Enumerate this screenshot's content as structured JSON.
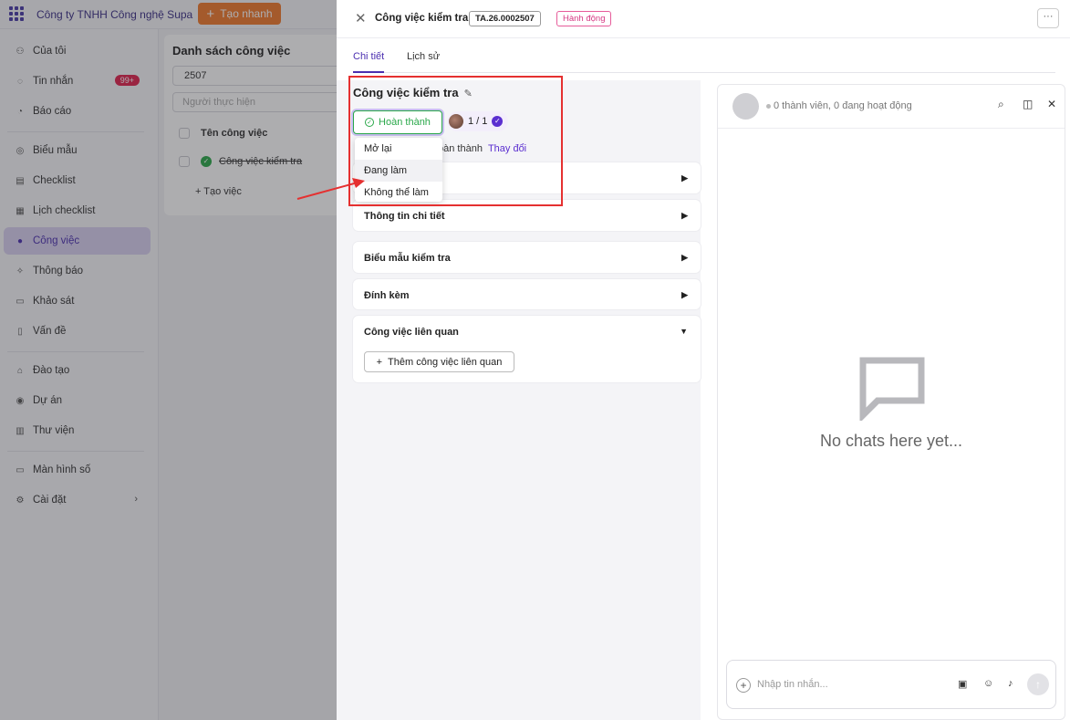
{
  "topbar": {
    "company": "Công ty TNHH Công nghệ Supa",
    "quick_create": "Tạo nhanh"
  },
  "sidebar": {
    "items": [
      {
        "label": "Của tôi",
        "icon": "person-icon"
      },
      {
        "label": "Tin nhắn",
        "icon": "chat-icon",
        "badge": "99+"
      },
      {
        "label": "Báo cáo",
        "icon": "report-icon"
      },
      {
        "label": "Biểu mẫu",
        "icon": "form-icon"
      },
      {
        "label": "Checklist",
        "icon": "checklist-icon"
      },
      {
        "label": "Lịch checklist",
        "icon": "calendar-icon"
      },
      {
        "label": "Công việc",
        "icon": "task-icon",
        "active": true
      },
      {
        "label": "Thông báo",
        "icon": "bell-icon"
      },
      {
        "label": "Khảo sát",
        "icon": "survey-icon"
      },
      {
        "label": "Vấn đề",
        "icon": "issue-icon"
      },
      {
        "label": "Đào tạo",
        "icon": "training-icon"
      },
      {
        "label": "Dự án",
        "icon": "project-icon"
      },
      {
        "label": "Thư viện",
        "icon": "library-icon"
      },
      {
        "label": "Màn hình số",
        "icon": "monitor-icon"
      },
      {
        "label": "Cài đặt",
        "icon": "settings-icon"
      }
    ]
  },
  "task_list": {
    "title": "Danh sách công việc",
    "search_value": "2507",
    "assignee_placeholder": "Người thực hiện",
    "column_name": "Tên công việc",
    "row_name": "Công việc kiểm tra",
    "add_task": "Tạo việc"
  },
  "drawer": {
    "title": "Công việc kiểm tra",
    "code": "TA.26.0002507",
    "action": "Hành động",
    "tabs": [
      "Chi tiết",
      "Lịch sử"
    ],
    "task_title": "Công việc kiểm tra",
    "status": "Hoàn thành",
    "assignee_count": "1 / 1",
    "completed_text": "oàn thành",
    "change_link": "Thay đổi",
    "dropdown": [
      "Mở lại",
      "Đang làm",
      "Không thể làm"
    ],
    "sections": [
      "Thông tin chi tiết",
      "Biểu mẫu kiểm tra",
      "Đính kèm",
      "Công việc liên quan"
    ],
    "add_related": "Thêm công việc liên quan"
  },
  "chat": {
    "meta": "0 thành viên, 0 đang hoạt động",
    "empty": "No chats here yet...",
    "placeholder": "Nhập tin nhắn..."
  },
  "colors": {
    "accent": "#4b2fb0",
    "success": "#2aa84a",
    "quick_create": "#f0792c",
    "highlight": "#e53030"
  }
}
